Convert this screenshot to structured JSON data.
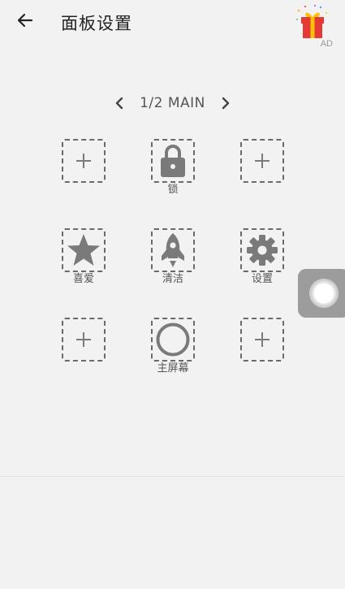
{
  "header": {
    "title": "面板设置",
    "ad_label": "AD"
  },
  "icons": {
    "back": "arrow-left-icon",
    "ad": "gift-box-icon",
    "prev": "chevron-left-icon",
    "next": "chevron-right-icon",
    "floating": "assistive-touch-icon"
  },
  "pager": {
    "label": "1/2 MAIN"
  },
  "grid": {
    "slots": [
      {
        "icon": "plus-icon",
        "label": ""
      },
      {
        "icon": "lock-icon",
        "label": "锁"
      },
      {
        "icon": "plus-icon",
        "label": ""
      },
      {
        "icon": "star-icon",
        "label": "喜爱"
      },
      {
        "icon": "rocket-icon",
        "label": "清洁"
      },
      {
        "icon": "gear-icon",
        "label": "设置"
      },
      {
        "icon": "plus-icon",
        "label": ""
      },
      {
        "icon": "circle-icon",
        "label": "主屏幕"
      },
      {
        "icon": "plus-icon",
        "label": ""
      }
    ]
  },
  "colors": {
    "background": "#f2f2f2",
    "icon_gray": "#7a7a7a",
    "border_dashed": "#6a6a6a",
    "gift_red": "#e53935",
    "gift_gold": "#ffc107",
    "floating_bg": "#9c9c9c"
  }
}
